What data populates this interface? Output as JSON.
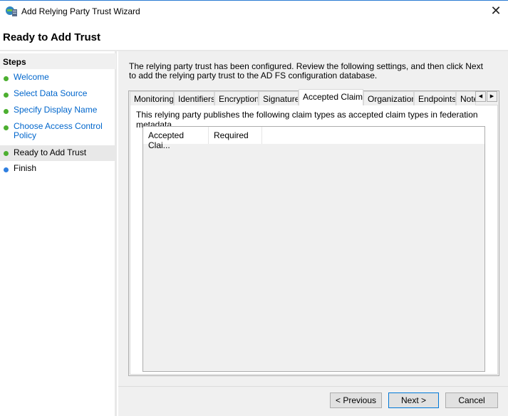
{
  "window": {
    "title": "Add Relying Party Trust Wizard",
    "icon": "adfs-wizard-icon",
    "close_icon": "close-icon"
  },
  "page": {
    "heading": "Ready to Add Trust",
    "intro": "The relying party trust has been configured. Review the following settings, and then click Next to add the relying party trust to the AD FS configuration database."
  },
  "steps": {
    "header": "Steps",
    "items": [
      {
        "label": "Welcome",
        "status": "complete"
      },
      {
        "label": "Select Data Source",
        "status": "complete"
      },
      {
        "label": "Specify Display Name",
        "status": "complete"
      },
      {
        "label": "Choose Access Control Policy",
        "status": "complete"
      },
      {
        "label": "Ready to Add Trust",
        "status": "current"
      },
      {
        "label": "Finish",
        "status": "pending"
      }
    ]
  },
  "tabs": [
    "Monitoring",
    "Identifiers",
    "Encryption",
    "Signature",
    "Accepted Claims",
    "Organization",
    "Endpoints",
    "Notes"
  ],
  "active_tab": "Accepted Claims",
  "claims": {
    "description": "This relying party publishes the following claim types as accepted claim types in federation metadata.",
    "columns": [
      "Accepted Clai...",
      "Required"
    ],
    "rows": []
  },
  "buttons": {
    "previous": "< Previous",
    "next": "Next >",
    "cancel": "Cancel"
  },
  "colors": {
    "complete": "#4caf30",
    "pending": "#2f7fe0",
    "link": "#0066cc"
  }
}
